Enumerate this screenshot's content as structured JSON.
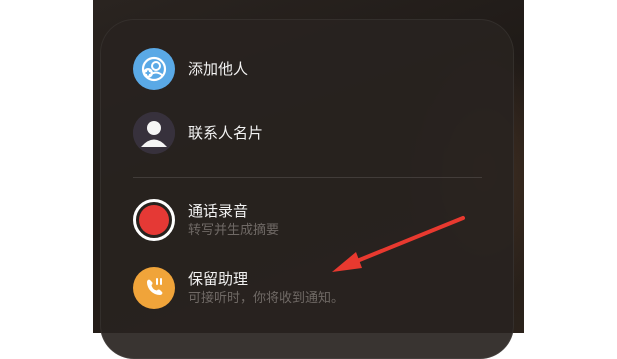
{
  "menu": {
    "items": [
      {
        "label": "添加他人",
        "icon": "add-person-icon",
        "icon_bg": "#5aa9e6"
      },
      {
        "label": "联系人名片",
        "icon": "contact-card-icon",
        "icon_bg": "#3a3440"
      },
      {
        "label": "通话录音",
        "sublabel": "转写并生成摘要",
        "icon": "record-icon",
        "icon_bg": "#e53935"
      },
      {
        "label": "保留助理",
        "sublabel": "可接听时，你将收到通知。",
        "icon": "hold-assist-icon",
        "icon_bg": "#f0a43a"
      }
    ]
  },
  "annotation": {
    "arrow_color": "#e8392f"
  }
}
